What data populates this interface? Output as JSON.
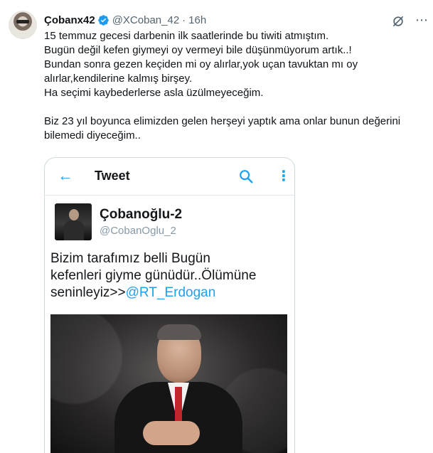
{
  "tweet": {
    "author_name": "Çobanx42",
    "handle": "@XCoban_42",
    "separator": "·",
    "time": "16h",
    "text_lines": [
      "15 temmuz gecesi darbenin ilk saatlerinde bu tiwiti atmıştım.",
      "Bugün değil kefen giymeyi oy vermeyi bile düşünmüyorum artık..!",
      "Bundan sonra gezen keçiden mi oy alırlar,yok uçan tavuktan mı oy",
      "alırlar,kendilerine kalmış birşey.",
      "Ha seçimi kaybederlerse asla üzülmeyeceğim."
    ],
    "text_lines_2": [
      "Biz 23 yıl boyunca elimizden gelen herşeyi yaptık ama onlar bunun değerini",
      "bilemedi diyeceğim.."
    ],
    "more_icon": "⋯"
  },
  "screenshot_card": {
    "header_title": "Tweet",
    "back_icon": "←",
    "kebab_icon": "⋮",
    "author_name": "Çobanoğlu-2",
    "handle": "@CobanOglu_2",
    "text_lines": [
      "Bizim tarafımız belli Bugün",
      "kefenleri giyme günüdür..Ölümüne"
    ],
    "text_last_prefix": "seninleyiz>>",
    "mention": "@RT_Erdogan"
  },
  "colors": {
    "accent": "#1da1f2",
    "verified": "#1d9bf0",
    "secondary_text": "#536471"
  }
}
